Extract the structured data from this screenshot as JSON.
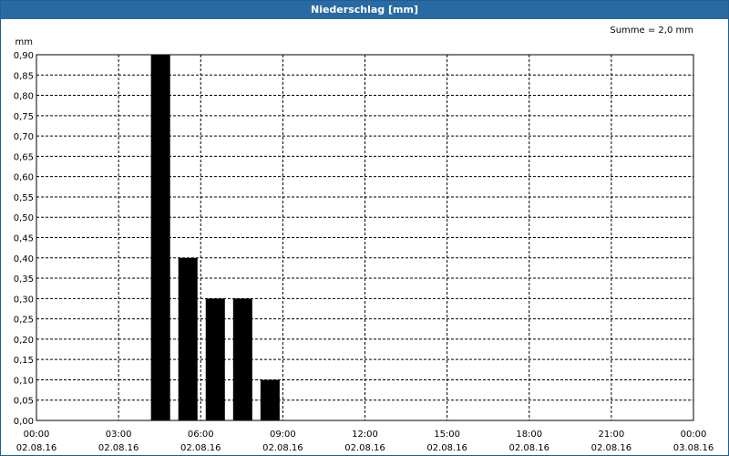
{
  "window": {
    "title": "Niederschlag [mm]"
  },
  "chart_data": {
    "type": "bar",
    "title": "Niederschlag [mm]",
    "ylabel": "mm",
    "annotation": "Summe = 2,0 mm",
    "ylim": [
      0,
      0.9
    ],
    "y_ticks": [
      "0,00",
      "0,05",
      "0,10",
      "0,15",
      "0,20",
      "0,25",
      "0,30",
      "0,35",
      "0,40",
      "0,45",
      "0,50",
      "0,55",
      "0,60",
      "0,65",
      "0,70",
      "0,75",
      "0,80",
      "0,85",
      "0,90"
    ],
    "x_range_hours": [
      0,
      24
    ],
    "x_ticks": [
      {
        "time": "00:00",
        "date": "02.08.16"
      },
      {
        "time": "03:00",
        "date": "02.08.16"
      },
      {
        "time": "06:00",
        "date": "02.08.16"
      },
      {
        "time": "09:00",
        "date": "02.08.16"
      },
      {
        "time": "12:00",
        "date": "02.08.16"
      },
      {
        "time": "15:00",
        "date": "02.08.16"
      },
      {
        "time": "18:00",
        "date": "02.08.16"
      },
      {
        "time": "21:00",
        "date": "02.08.16"
      },
      {
        "time": "00:00",
        "date": "03.08.16"
      }
    ],
    "bars": [
      {
        "time": "04:00-05:00",
        "value": 0.9
      },
      {
        "time": "05:00-06:00",
        "value": 0.4
      },
      {
        "time": "06:00-07:00",
        "value": 0.3
      },
      {
        "time": "07:00-08:00",
        "value": 0.3
      },
      {
        "time": "08:00-09:00",
        "value": 0.1
      }
    ],
    "grid": true,
    "colors": {
      "bar": "#000000",
      "titlebar": "#2a6aa3"
    }
  }
}
